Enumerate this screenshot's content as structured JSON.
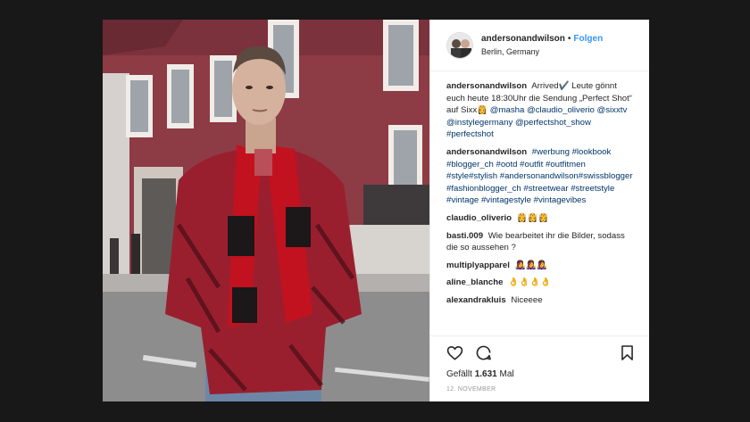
{
  "colors": {
    "link_blue": "#3897f0",
    "hashtag_navy": "#003569",
    "muted_gray": "#999999",
    "border_gray": "#efefef"
  },
  "header": {
    "username": "andersonandwilson",
    "separator": "•",
    "follow_label": "Folgen",
    "location": "Berlin, Germany"
  },
  "caption": {
    "username": "andersonandwilson",
    "text_1": "Arrived✔️ Leute gönnt euch heute 18:30Uhr die Sendung „Perfect Shot“ auf Sixx👸",
    "mentions": [
      "@masha",
      "@claudio_oliverio",
      "@sixxtv",
      "@instylegermany",
      "@perfectshot_show",
      "#perfectshot"
    ]
  },
  "comments": [
    {
      "username": "andersonandwilson",
      "hashtags": [
        "#werbung",
        "#lookbook",
        "#blogger_ch",
        "#ootd",
        "#outfit",
        "#outfitmen",
        "#style",
        "#stylish",
        "#andersonandwilson",
        "#swissblogger",
        "#fashionblogger_ch",
        "#streetwear",
        "#streetstyle",
        "#vintage",
        "#vintagestyle",
        "#vintagevibes"
      ]
    },
    {
      "username": "claudio_oliverio",
      "text": "👸👸👸"
    },
    {
      "username": "basti.009",
      "text": "Wie bearbeitet ihr die Bilder, sodass die so aussehen ?"
    },
    {
      "username": "multiplyapparel",
      "text": "👩‍🎤👩‍🎤👩‍🎤"
    },
    {
      "username": "aline_blanche",
      "text": "👌👌👌👌"
    },
    {
      "username": "alexandrakluis",
      "text": "Niceeee"
    }
  ],
  "actions": {
    "like_icon": "heart-icon",
    "comment_icon": "comment-icon",
    "save_icon": "bookmark-icon"
  },
  "likes": {
    "label": "Gefällt",
    "count": "1.631",
    "suffix": "Mal"
  },
  "date": "12. NOVEMBER"
}
